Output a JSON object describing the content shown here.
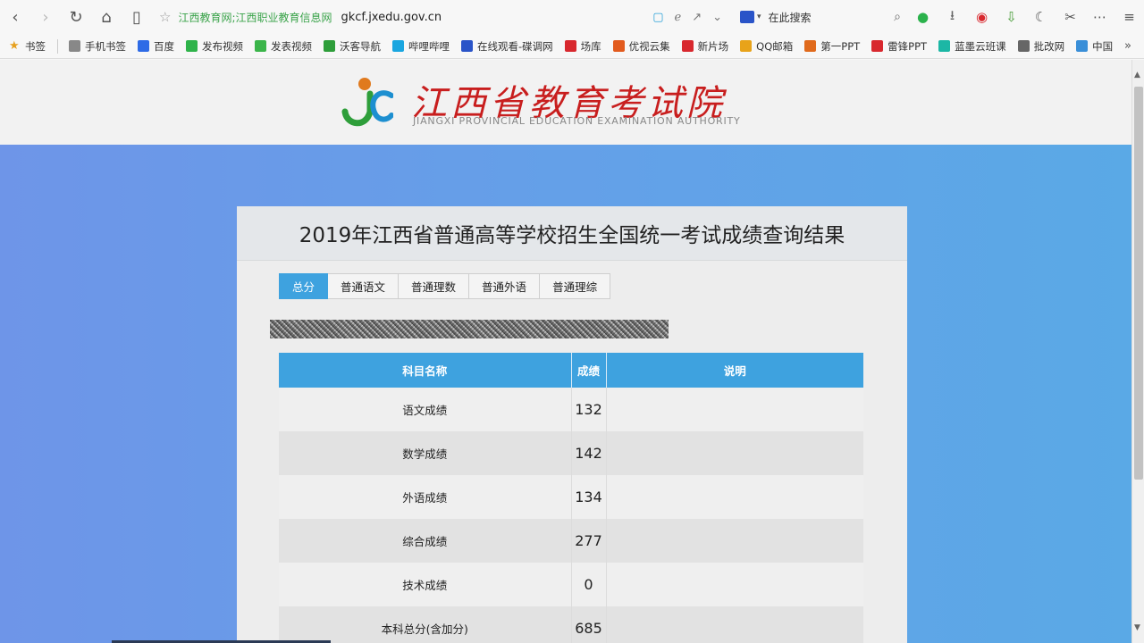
{
  "browser": {
    "site_title": "江西教育网;江西职业教育信息网",
    "url": "gkcf.jxedu.gov.cn",
    "search_placeholder": "在此搜索"
  },
  "bookmarks": [
    {
      "label": "书签",
      "icon": "star-icon",
      "color": "#e6a01e"
    },
    {
      "label": "手机书签",
      "icon": "phone-icon",
      "color": "#888888"
    },
    {
      "label": "百度",
      "icon": "baidu-paw-icon",
      "color": "#2e6be6"
    },
    {
      "label": "发布视频",
      "icon": "video-icon",
      "color": "#2fb34a"
    },
    {
      "label": "发表视频",
      "icon": "play-icon",
      "color": "#3bb54a"
    },
    {
      "label": "沃客导航",
      "icon": "wok-icon",
      "color": "#2e9e3a"
    },
    {
      "label": "哔哩哔哩",
      "icon": "bilibili-icon",
      "color": "#1aa6e0"
    },
    {
      "label": "在线观看-碟调网",
      "icon": "disc-icon",
      "color": "#2a54c8"
    },
    {
      "label": "场库",
      "icon": "new-badge-icon",
      "color": "#d8282e"
    },
    {
      "label": "优视云集",
      "icon": "cloud-icon",
      "color": "#e25b1e"
    },
    {
      "label": "新片场",
      "icon": "new-badge-icon",
      "color": "#d8282e"
    },
    {
      "label": "QQ邮箱",
      "icon": "qq-mail-icon",
      "color": "#e8a31a"
    },
    {
      "label": "第一PPT",
      "icon": "ppt-icon",
      "color": "#e06a1c"
    },
    {
      "label": "雷锋PPT",
      "icon": "leifeng-icon",
      "color": "#d8282e"
    },
    {
      "label": "蓝墨云班课",
      "icon": "mosoteach-icon",
      "color": "#1cb7a5"
    },
    {
      "label": "批改网",
      "icon": "pigai-icon",
      "color": "#666666"
    },
    {
      "label": "中国",
      "icon": "flag-icon",
      "color": "#3a8fd8"
    }
  ],
  "header": {
    "logo_cn": "江西省教育考试院",
    "logo_en": "JIANGXI PROVINCIAL EDUCATION EXAMINATION AUTHORITY"
  },
  "panel": {
    "title": "2019年江西省普通高等学校招生全国统一考试成绩查询结果",
    "tabs": [
      "总分",
      "普通语文",
      "普通理数",
      "普通外语",
      "普通理综"
    ],
    "active_tab": 0,
    "table": {
      "headers": [
        "科目名称",
        "成绩",
        "说明"
      ],
      "rows": [
        {
          "name": "语文成绩",
          "score": "132",
          "note": ""
        },
        {
          "name": "数学成绩",
          "score": "142",
          "note": ""
        },
        {
          "name": "外语成绩",
          "score": "134",
          "note": ""
        },
        {
          "name": "综合成绩",
          "score": "277",
          "note": ""
        },
        {
          "name": "技术成绩",
          "score": "0",
          "note": ""
        },
        {
          "name": "本科总分(含加分)",
          "score": "685",
          "note": ""
        }
      ]
    }
  },
  "colors": {
    "accent_blue": "#3ea2df",
    "logo_red": "#c81e1e",
    "site_green": "#3aa34a"
  }
}
